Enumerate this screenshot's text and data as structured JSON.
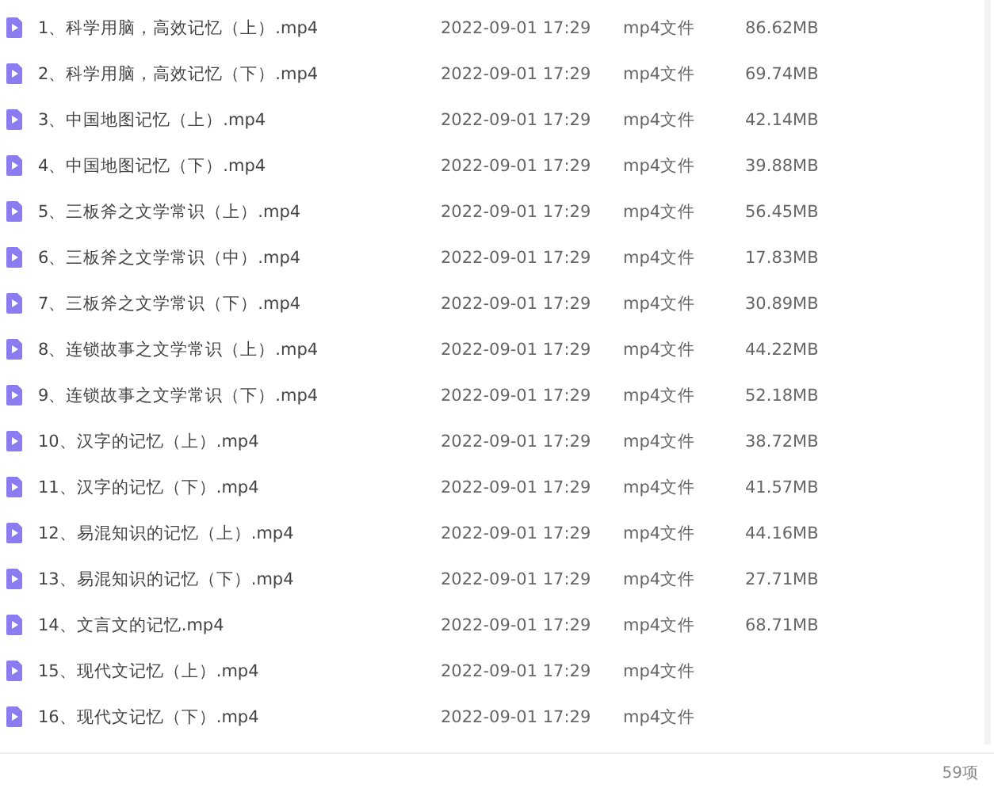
{
  "files": [
    {
      "name": "1、科学用脑，高效记忆（上）.mp4",
      "modified": "2022-09-01 17:29",
      "type": "mp4文件",
      "size": "86.62MB"
    },
    {
      "name": "2、科学用脑，高效记忆（下）.mp4",
      "modified": "2022-09-01 17:29",
      "type": "mp4文件",
      "size": "69.74MB"
    },
    {
      "name": "3、中国地图记忆（上）.mp4",
      "modified": "2022-09-01 17:29",
      "type": "mp4文件",
      "size": "42.14MB"
    },
    {
      "name": "4、中国地图记忆（下）.mp4",
      "modified": "2022-09-01 17:29",
      "type": "mp4文件",
      "size": "39.88MB"
    },
    {
      "name": "5、三板斧之文学常识（上）.mp4",
      "modified": "2022-09-01 17:29",
      "type": "mp4文件",
      "size": "56.45MB"
    },
    {
      "name": "6、三板斧之文学常识（中）.mp4",
      "modified": "2022-09-01 17:29",
      "type": "mp4文件",
      "size": "17.83MB"
    },
    {
      "name": "7、三板斧之文学常识（下）.mp4",
      "modified": "2022-09-01 17:29",
      "type": "mp4文件",
      "size": "30.89MB"
    },
    {
      "name": "8、连锁故事之文学常识（上）.mp4",
      "modified": "2022-09-01 17:29",
      "type": "mp4文件",
      "size": "44.22MB"
    },
    {
      "name": "9、连锁故事之文学常识（下）.mp4",
      "modified": "2022-09-01 17:29",
      "type": "mp4文件",
      "size": "52.18MB"
    },
    {
      "name": "10、汉字的记忆（上）.mp4",
      "modified": "2022-09-01 17:29",
      "type": "mp4文件",
      "size": "38.72MB"
    },
    {
      "name": "11、汉字的记忆（下）.mp4",
      "modified": "2022-09-01 17:29",
      "type": "mp4文件",
      "size": "41.57MB"
    },
    {
      "name": "12、易混知识的记忆（上）.mp4",
      "modified": "2022-09-01 17:29",
      "type": "mp4文件",
      "size": "44.16MB"
    },
    {
      "name": "13、易混知识的记忆（下）.mp4",
      "modified": "2022-09-01 17:29",
      "type": "mp4文件",
      "size": "27.71MB"
    },
    {
      "name": "14、文言文的记忆.mp4",
      "modified": "2022-09-01 17:29",
      "type": "mp4文件",
      "size": "68.71MB"
    },
    {
      "name": "15、现代文记忆（上）.mp4",
      "modified": "2022-09-01 17:29",
      "type": "mp4文件"
    },
    {
      "name": "16、现代文记忆（下）.mp4",
      "modified": "2022-09-01 17:29",
      "type": "mp4文件"
    }
  ],
  "status_bar": {
    "count": "59项"
  }
}
